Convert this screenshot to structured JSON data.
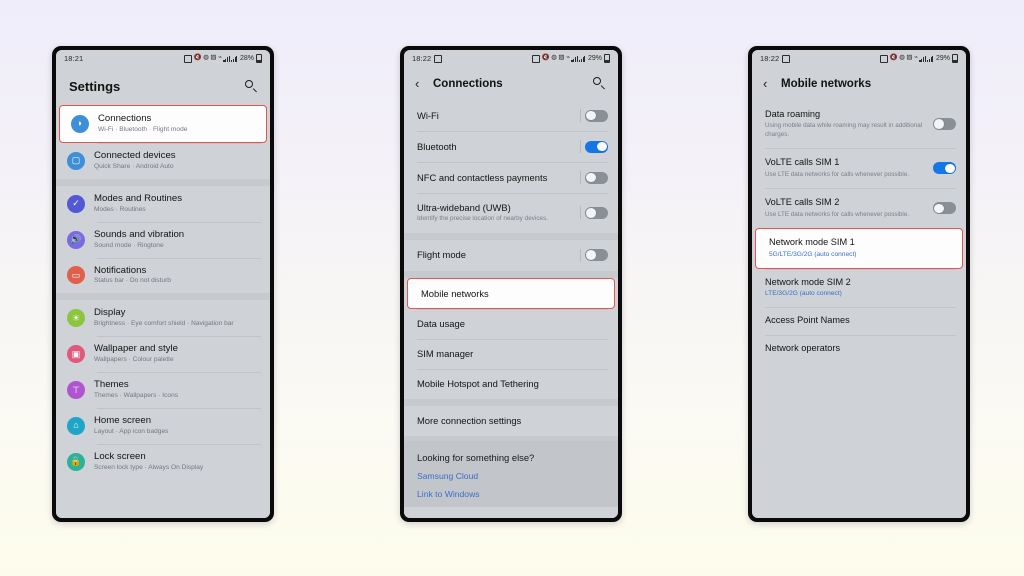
{
  "background": {
    "top_color": "#efedfa",
    "bottom_color": "#fdfcec"
  },
  "accent": {
    "highlight_border": "#e2564f",
    "toggle_on": "#1676e8",
    "link": "#3a6ec6"
  },
  "phones": [
    {
      "id": "settings",
      "status": {
        "time": "18:21",
        "battery": "28%"
      },
      "header": {
        "title": "Settings",
        "search_icon": "search-icon"
      },
      "items": [
        {
          "title": "Connections",
          "sub": "Wi-Fi  ·  Bluetooth  ·  Flight mode",
          "icon": "wifi-icon",
          "color": "#3f8fd8",
          "highlighted": true
        },
        {
          "title": "Connected devices",
          "sub": "Quick Share  ·  Android Auto",
          "icon": "devices-icon",
          "color": "#3f8fd8",
          "highlighted": false
        },
        {
          "title": "Modes and Routines",
          "sub": "Modes  ·  Routines",
          "icon": "modes-icon",
          "color": "#5358d4",
          "highlighted": false
        },
        {
          "title": "Sounds and vibration",
          "sub": "Sound mode  ·  Ringtone",
          "icon": "sound-icon",
          "color": "#7b6be2",
          "highlighted": false
        },
        {
          "title": "Notifications",
          "sub": "Status bar  ·  Do not disturb",
          "icon": "notification-icon",
          "color": "#e1604d",
          "highlighted": false
        },
        {
          "title": "Display",
          "sub": "Brightness  ·  Eye comfort shield  ·  Navigation bar",
          "icon": "display-icon",
          "color": "#8cc63f",
          "highlighted": false
        },
        {
          "title": "Wallpaper and style",
          "sub": "Wallpapers  ·  Colour palette",
          "icon": "wallpaper-icon",
          "color": "#e0587c",
          "highlighted": false
        },
        {
          "title": "Themes",
          "sub": "Themes  ·  Wallpapers  ·  Icons",
          "icon": "themes-icon",
          "color": "#b055d0",
          "highlighted": false
        },
        {
          "title": "Home screen",
          "sub": "Layout  ·  App icon badges",
          "icon": "home-icon",
          "color": "#1ea6c9",
          "highlighted": false
        },
        {
          "title": "Lock screen",
          "sub": "Screen lock type  ·  Always On Display",
          "icon": "lock-icon",
          "color": "#2cb397",
          "highlighted": false
        }
      ]
    },
    {
      "id": "connections",
      "status": {
        "time": "18:22",
        "battery": "29%"
      },
      "header": {
        "title": "Connections",
        "back_icon": "back-chevron-icon",
        "search_icon": "search-icon"
      },
      "items": [
        {
          "title": "Wi-Fi",
          "sub": "",
          "toggle": "off",
          "highlighted": false
        },
        {
          "title": "Bluetooth",
          "sub": "",
          "toggle": "on",
          "highlighted": false
        },
        {
          "title": "NFC and contactless payments",
          "sub": "",
          "toggle": "off",
          "highlighted": false
        },
        {
          "title": "Ultra-wideband (UWB)",
          "sub": "Identify the precise location of nearby devices.",
          "toggle": "off",
          "highlighted": false
        },
        {
          "title": "Flight mode",
          "sub": "",
          "toggle": "off",
          "highlighted": false,
          "gap_before": true
        },
        {
          "title": "Mobile networks",
          "sub": "",
          "toggle": "none",
          "highlighted": true,
          "gap_before": true
        },
        {
          "title": "Data usage",
          "sub": "",
          "toggle": "none",
          "highlighted": false
        },
        {
          "title": "SIM manager",
          "sub": "",
          "toggle": "none",
          "highlighted": false
        },
        {
          "title": "Mobile Hotspot and Tethering",
          "sub": "",
          "toggle": "none",
          "highlighted": false
        },
        {
          "title": "More connection settings",
          "sub": "",
          "toggle": "none",
          "highlighted": false,
          "gap_before": true
        }
      ],
      "footer": {
        "title": "Looking for something else?",
        "links": [
          "Samsung Cloud",
          "Link to Windows"
        ]
      }
    },
    {
      "id": "mobile-networks",
      "status": {
        "time": "18:22",
        "battery": "29%"
      },
      "header": {
        "title": "Mobile networks",
        "back_icon": "back-chevron-icon"
      },
      "items": [
        {
          "title": "Data roaming",
          "sub": "Using mobile data while roaming may result in additional charges.",
          "toggle": "off",
          "highlighted": false
        },
        {
          "title": "VoLTE calls SIM 1",
          "sub": "Use LTE data networks for calls whenever possible.",
          "toggle": "on",
          "highlighted": false
        },
        {
          "title": "VoLTE calls SIM 2",
          "sub": "Use LTE data networks for calls whenever possible.",
          "toggle": "off",
          "highlighted": false
        },
        {
          "title": "Network mode SIM 1",
          "sub": "5G/LTE/3G/2G (auto connect)",
          "sub_blue": true,
          "toggle": "none",
          "highlighted": true
        },
        {
          "title": "Network mode SIM 2",
          "sub": "LTE/3G/2G (auto connect)",
          "sub_blue": true,
          "toggle": "none",
          "highlighted": false
        },
        {
          "title": "Access Point Names",
          "sub": "",
          "toggle": "none",
          "highlighted": false
        },
        {
          "title": "Network operators",
          "sub": "",
          "toggle": "none",
          "highlighted": false
        }
      ]
    }
  ]
}
